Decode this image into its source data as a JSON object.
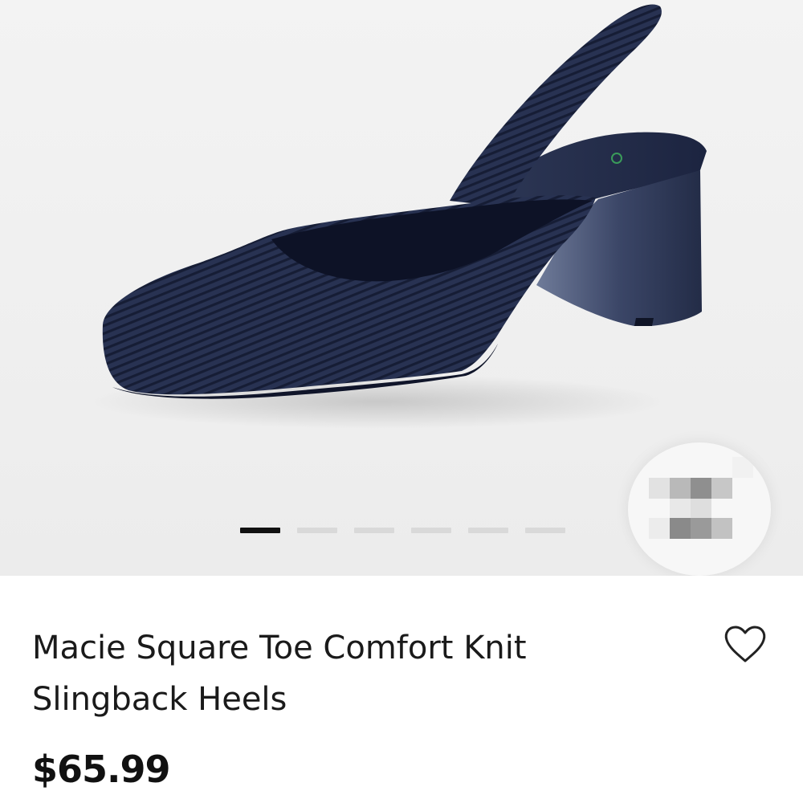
{
  "product": {
    "title": "Macie Square Toe Comfort Knit\nSlingback Heels",
    "price": "$65.99",
    "color_swatch": "#2b3450"
  },
  "gallery": {
    "image_count": 6,
    "active_index": 0
  },
  "icons": {
    "favorite": "heart-outline-icon"
  },
  "colors": {
    "text": "#1a1a1a",
    "indicator_active": "#111111",
    "indicator_inactive": "#d9d9d9",
    "gallery_bg": "#f0f0f0"
  }
}
